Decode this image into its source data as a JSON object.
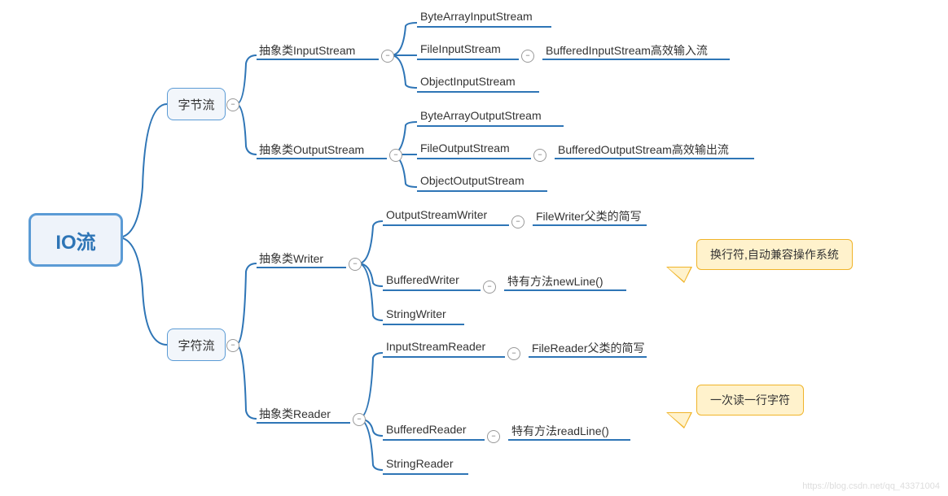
{
  "root": "IO流",
  "cat1": "字节流",
  "cat2": "字符流",
  "in_abs": "抽象类InputStream",
  "out_abs": "抽象类OutputStream",
  "writer_abs": "抽象类Writer",
  "reader_abs": "抽象类Reader",
  "bais": "ByteArrayInputStream",
  "fis": "FileInputStream",
  "ois": "ObjectInputStream",
  "bis": "BufferedInputStream高效输入流",
  "baos": "ByteArrayOutputStream",
  "fos": "FileOutputStream",
  "oos": "ObjectOutputStream",
  "bos": "BufferedOutputStream高效输出流",
  "osw": "OutputStreamWriter",
  "bw": "BufferedWriter",
  "sw": "StringWriter",
  "fw_note": "FileWriter父类的简写",
  "bw_method": "特有方法newLine()",
  "isr": "InputStreamReader",
  "br": "BufferedReader",
  "sr": "StringReader",
  "fr_note": "FileReader父类的简写",
  "br_method": "特有方法readLine()",
  "note1": "换行符,自动兼容操作系统",
  "note2": "一次读一行字符",
  "watermark": "https://blog.csdn.net/qq_43371004"
}
